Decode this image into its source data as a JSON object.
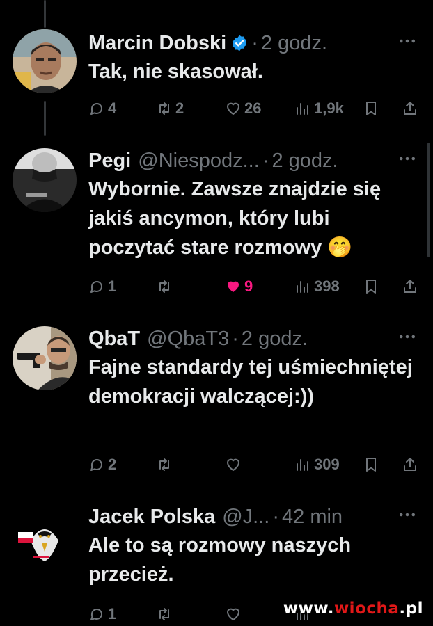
{
  "tweets": [
    {
      "name": "Marcin Dobski",
      "verified": true,
      "handle": "",
      "separator": "·",
      "time": "2 godz.",
      "text": "Tak, nie skasował.",
      "actions": {
        "replies": "4",
        "reposts": "2",
        "likes": "26",
        "views": "1,9k"
      },
      "liked": false
    },
    {
      "name": "Pegi",
      "verified": false,
      "handle": "@Niespodz...",
      "separator": "·",
      "time": "2 godz.",
      "text": "Wybornie. Zawsze znajdzie się jakiś ancymon, który lubi poczytać stare rozmowy 🤭",
      "actions": {
        "replies": "1",
        "reposts": "",
        "likes": "9",
        "views": "398"
      },
      "liked": true
    },
    {
      "name": "QbaT",
      "verified": false,
      "handle": "@QbaT3",
      "separator": "·",
      "time": "2 godz.",
      "text": "Fajne standardy tej uśmiechniętej demokracji walczącej:))",
      "actions": {
        "replies": "2",
        "reposts": "",
        "likes": "",
        "views": "309"
      },
      "liked": false
    },
    {
      "name": "Jacek Polska",
      "verified": false,
      "handle": "@J...",
      "separator": "·",
      "time": "42 min",
      "text": "Ale to są rozmowy naszych przecież.",
      "actions": {
        "replies": "1",
        "reposts": "",
        "likes": "",
        "views": ""
      },
      "liked": false
    }
  ],
  "icons": {
    "reply": "reply-icon",
    "repost": "repost-icon",
    "like": "like-icon",
    "views": "views-icon",
    "bookmark": "bookmark-icon",
    "share": "share-icon",
    "more": "more-icon",
    "verified": "verified-badge-icon"
  },
  "colors": {
    "background": "#000000",
    "text": "#e7e9ea",
    "muted": "#71767b",
    "like": "#f91880",
    "verified": "#1d9bf0"
  },
  "watermark": {
    "site": "www.",
    "brand": "wiocha",
    "tld": ".pl"
  }
}
